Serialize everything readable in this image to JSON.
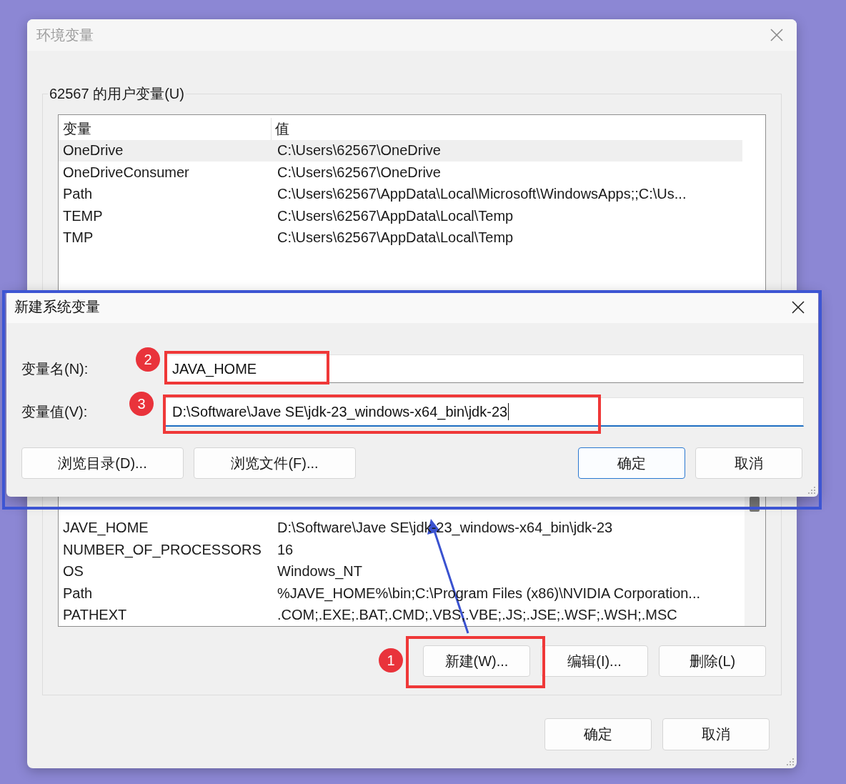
{
  "main_window": {
    "title": "环境变量",
    "user_group": {
      "title": "62567 的用户变量(U)",
      "columns": [
        "变量",
        "值"
      ],
      "rows": [
        {
          "name": "OneDrive",
          "value": "C:\\Users\\62567\\OneDrive",
          "selected": true
        },
        {
          "name": "OneDriveConsumer",
          "value": "C:\\Users\\62567\\OneDrive",
          "selected": false
        },
        {
          "name": "Path",
          "value": "C:\\Users\\62567\\AppData\\Local\\Microsoft\\WindowsApps;;C:\\Us...",
          "selected": false
        },
        {
          "name": "TEMP",
          "value": "C:\\Users\\62567\\AppData\\Local\\Temp",
          "selected": false
        },
        {
          "name": "TMP",
          "value": "C:\\Users\\62567\\AppData\\Local\\Temp",
          "selected": false
        }
      ]
    },
    "system_group": {
      "rows": [
        {
          "name": "JAVE_HOME",
          "value": "D:\\Software\\Jave SE\\jdk-23_windows-x64_bin\\jdk-23",
          "selected": false
        },
        {
          "name": "NUMBER_OF_PROCESSORS",
          "value": "16",
          "selected": false
        },
        {
          "name": "OS",
          "value": "Windows_NT",
          "selected": false
        },
        {
          "name": "Path",
          "value": "%JAVE_HOME%\\bin;C:\\Program Files (x86)\\NVIDIA Corporation...",
          "selected": false
        },
        {
          "name": "PATHEXT",
          "value": ".COM;.EXE;.BAT;.CMD;.VBS;.VBE;.JS;.JSE;.WSF;.WSH;.MSC",
          "selected": false
        }
      ],
      "buttons": [
        "新建(W)...",
        "编辑(I)...",
        "删除(L)"
      ]
    },
    "buttons": [
      "确定",
      "取消"
    ]
  },
  "dialog": {
    "title": "新建系统变量",
    "fields": [
      {
        "label": "变量名(N):",
        "value": "JAVA_HOME",
        "focused": false
      },
      {
        "label": "变量值(V):",
        "value": "D:\\Software\\Jave SE\\jdk-23_windows-x64_bin\\jdk-23",
        "focused": true
      }
    ],
    "buttons": [
      {
        "label": "浏览目录(D)...",
        "default": false
      },
      {
        "label": "浏览文件(F)...",
        "default": false
      },
      {
        "label": "确定",
        "default": true
      },
      {
        "label": "取消",
        "default": false
      }
    ]
  },
  "annotations": [
    {
      "label": "1"
    },
    {
      "label": "2"
    },
    {
      "label": "3"
    }
  ]
}
